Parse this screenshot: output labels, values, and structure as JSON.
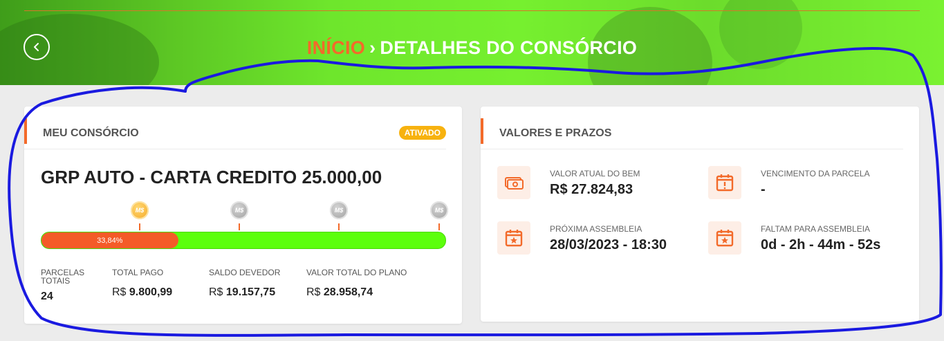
{
  "header": {
    "breadcrumb_home": "INÍCIO",
    "breadcrumb_sep": "›",
    "breadcrumb_current": "DETALHES DO CONSÓRCIO",
    "back_icon": "chevron-left-icon"
  },
  "left_card": {
    "title": "MEU CONSÓRCIO",
    "badge": "ATIVADO",
    "plan_name": "GRP AUTO - CARTA CREDITO 25.000,00",
    "coin_label": "M$",
    "progress": {
      "value": 0.3384,
      "label": "33,84%"
    },
    "milestones": [
      "reached",
      "pending",
      "pending",
      "pending"
    ],
    "stats": [
      {
        "label": "PARCELAS TOTAIS",
        "prefix": "",
        "value": "24"
      },
      {
        "label": "TOTAL PAGO",
        "prefix": "R$",
        "value": "9.800,99"
      },
      {
        "label": "SALDO DEVEDOR",
        "prefix": "R$",
        "value": "19.157,75"
      },
      {
        "label": "VALOR TOTAL DO PLANO",
        "prefix": "R$",
        "value": "28.958,74"
      }
    ]
  },
  "right_card": {
    "title": "VALORES E PRAZOS",
    "items": [
      {
        "icon": "money-icon",
        "label": "VALOR ATUAL DO BEM",
        "value": "R$ 27.824,83"
      },
      {
        "icon": "calendar-alert-icon",
        "label": "VENCIMENTO DA PARCELA",
        "value": "-"
      },
      {
        "icon": "calendar-star-icon",
        "label": "PRÓXIMA ASSEMBLEIA",
        "value": "28/03/2023 - 18:30"
      },
      {
        "icon": "calendar-star-icon",
        "label": "FALTAM PARA ASSEMBLEIA",
        "value": "0d - 2h - 44m - 52s"
      }
    ]
  },
  "colors": {
    "accent": "#f36a2a",
    "badge": "#f7b20f",
    "progress_track": "#5cff0c",
    "progress_fill": "#f45b28",
    "scribble": "#1a1ae0"
  }
}
